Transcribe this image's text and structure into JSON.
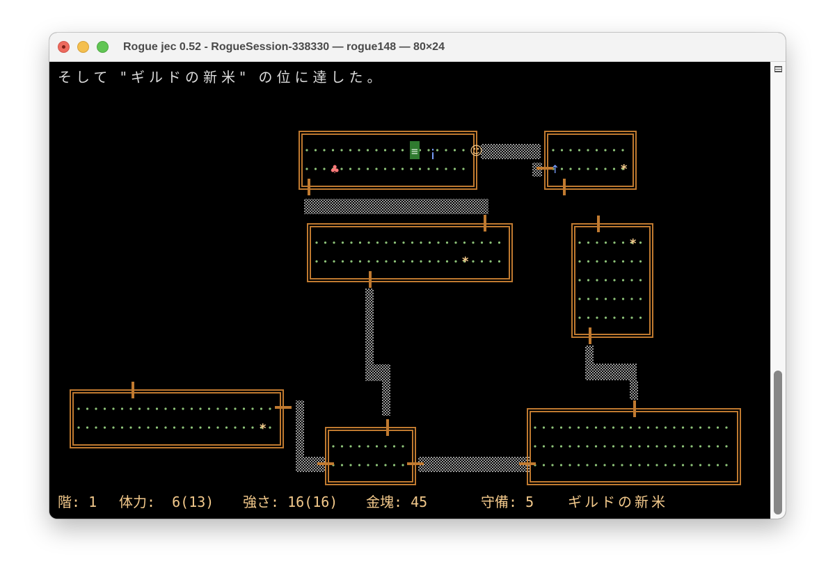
{
  "window": {
    "title": "Rogue jec 0.52 - RogueSession-338330 — rogue148 — 80×24"
  },
  "terminal": {
    "message": "そして \"ギルドの新米\" の位に達した。",
    "status": [
      "階: 1",
      "体力:  6(13)",
      "強さ: 16(16)",
      "金塊: 45",
      "守備: 5",
      "ギルドの新米"
    ],
    "map_glyphs": {
      "player": "☺",
      "stairs": "≡",
      "potion": "¡",
      "food": "♣",
      "weapon": "↑",
      "gold": "*"
    }
  },
  "colors": {
    "wall": "#c07a30",
    "floor": "#8fc57a",
    "passage": "#9a9a9a",
    "status_text": "#f3c98b",
    "message_text": "#dcdcdc",
    "player": "#f3c98b",
    "stairs": "#2f7a2f",
    "potion": "#7aa0ff",
    "food": "#ff7a7a",
    "gold": "#f3c98b"
  }
}
